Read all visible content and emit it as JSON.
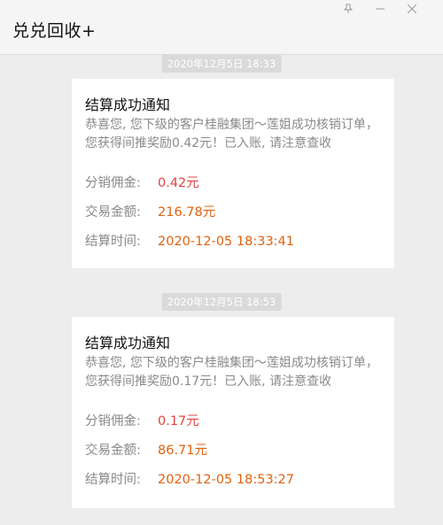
{
  "header": {
    "title": "兑兑回收+"
  },
  "messages": [
    {
      "timestamp": "2020年12月5日 18:33",
      "title": "结算成功通知",
      "body": "恭喜您, 您下级的客户桂融集团～莲姐成功核销订单，您获得间推奖励0.42元！已入账, 请注意查收",
      "commission_label": "分销佣金:",
      "commission_value": "0.42元",
      "amount_label": "交易金额:",
      "amount_value": "216.78元",
      "time_label": "结算时间:",
      "time_value": "2020-12-05 18:33:41"
    },
    {
      "timestamp": "2020年12月5日 18:53",
      "title": "结算成功通知",
      "body": "恭喜您, 您下级的客户桂融集团～莲姐成功核销订单，您获得间推奖励0.17元！已入账, 请注意查收",
      "commission_label": "分销佣金:",
      "commission_value": "0.17元",
      "amount_label": "交易金额:",
      "amount_value": "86.71元",
      "time_label": "结算时间:",
      "time_value": "2020-12-05 18:53:27"
    }
  ],
  "colors": {
    "commission": "#e64340",
    "highlight": "#e0620d",
    "muted": "#8a8a8a",
    "background": "#ededed"
  },
  "icons": {
    "pin": "pin-icon",
    "minimize": "minimize-icon",
    "close": "close-icon"
  }
}
